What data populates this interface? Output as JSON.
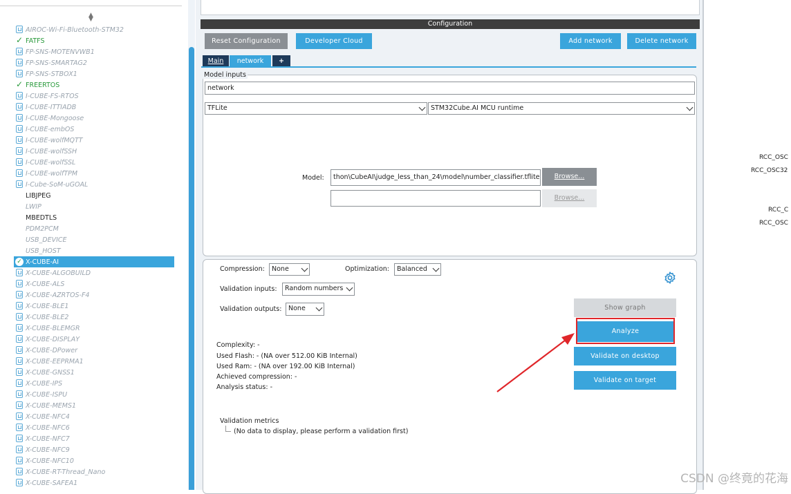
{
  "left_panel": {
    "items": [
      {
        "label": "AIROC-Wi-Fi-Bluetooth-STM32",
        "state": "pack"
      },
      {
        "label": "FATFS",
        "state": "ok"
      },
      {
        "label": "FP-SNS-MOTENVWB1",
        "state": "pack"
      },
      {
        "label": "FP-SNS-SMARTAG2",
        "state": "pack"
      },
      {
        "label": "FP-SNS-STBOX1",
        "state": "pack"
      },
      {
        "label": "FREERTOS",
        "state": "ok"
      },
      {
        "label": "I-CUBE-FS-RTOS",
        "state": "pack"
      },
      {
        "label": "I-CUBE-ITTIADB",
        "state": "pack"
      },
      {
        "label": "I-CUBE-Mongoose",
        "state": "pack"
      },
      {
        "label": "I-CUBE-embOS",
        "state": "pack"
      },
      {
        "label": "I-CUBE-wolfMQTT",
        "state": "pack"
      },
      {
        "label": "I-CUBE-wolfSSH",
        "state": "pack"
      },
      {
        "label": "I-CUBE-wolfSSL",
        "state": "pack"
      },
      {
        "label": "I-CUBE-wolfTPM",
        "state": "pack"
      },
      {
        "label": "I-Cube-SoM-uGOAL",
        "state": "pack"
      },
      {
        "label": "LIBJPEG",
        "state": "plain"
      },
      {
        "label": "LWIP",
        "state": "plaindis"
      },
      {
        "label": "MBEDTLS",
        "state": "plain"
      },
      {
        "label": "PDM2PCM",
        "state": "plaindis"
      },
      {
        "label": "USB_DEVICE",
        "state": "plaindis"
      },
      {
        "label": "USB_HOST",
        "state": "plaindis"
      },
      {
        "label": "X-CUBE-AI",
        "state": "sel"
      },
      {
        "label": "X-CUBE-ALGOBUILD",
        "state": "pack"
      },
      {
        "label": "X-CUBE-ALS",
        "state": "pack"
      },
      {
        "label": "X-CUBE-AZRTOS-F4",
        "state": "pack"
      },
      {
        "label": "X-CUBE-BLE1",
        "state": "pack"
      },
      {
        "label": "X-CUBE-BLE2",
        "state": "pack"
      },
      {
        "label": "X-CUBE-BLEMGR",
        "state": "pack"
      },
      {
        "label": "X-CUBE-DISPLAY",
        "state": "pack"
      },
      {
        "label": "X-CUBE-DPower",
        "state": "pack"
      },
      {
        "label": "X-CUBE-EEPRMA1",
        "state": "pack"
      },
      {
        "label": "X-CUBE-GNSS1",
        "state": "pack"
      },
      {
        "label": "X-CUBE-IPS",
        "state": "pack"
      },
      {
        "label": "X-CUBE-ISPU",
        "state": "pack"
      },
      {
        "label": "X-CUBE-MEMS1",
        "state": "pack"
      },
      {
        "label": "X-CUBE-NFC4",
        "state": "pack"
      },
      {
        "label": "X-CUBE-NFC6",
        "state": "pack"
      },
      {
        "label": "X-CUBE-NFC7",
        "state": "pack"
      },
      {
        "label": "X-CUBE-NFC9",
        "state": "pack"
      },
      {
        "label": "X-CUBE-NFC10",
        "state": "pack"
      },
      {
        "label": "X-CUBE-RT-Thread_Nano",
        "state": "pack"
      },
      {
        "label": "X-CUBE-SAFEA1",
        "state": "pack"
      }
    ]
  },
  "config": {
    "title": "Configuration",
    "reset_label": "Reset Configuration",
    "devcloud_label": "Developer Cloud",
    "add_network_label": "Add network",
    "delete_network_label": "Delete network",
    "tabs": [
      "Main",
      "network",
      "+"
    ]
  },
  "model_inputs": {
    "legend": "Model inputs",
    "name_value": "network",
    "framework": "TFLite",
    "runtime": "STM32Cube.AI MCU runtime",
    "model_label": "Model:",
    "model_path": "thon\\CubeAI\\judge_less_than_24\\model\\number_classifier.tflite",
    "browse_label": "Browse...",
    "browse2_label": "Browse..."
  },
  "options": {
    "compression_label": "Compression:",
    "compression_value": "None",
    "optimization_label": "Optimization:",
    "optimization_value": "Balanced",
    "val_inputs_label": "Validation inputs:",
    "val_inputs_value": "Random numbers",
    "val_outputs_label": "Validation outputs:",
    "val_outputs_value": "None",
    "show_graph_label": "Show graph",
    "analyze_label": "Analyze",
    "validate_desktop_label": "Validate on desktop",
    "validate_target_label": "Validate on target"
  },
  "analysis": {
    "complexity": "Complexity: -",
    "used_flash": "Used Flash: - (NA over 512.00 KiB Internal)",
    "used_ram": "Used Ram: - (NA over 192.00 KiB Internal)",
    "achieved_compression": "Achieved compression: -",
    "analysis_status": "Analysis status: -"
  },
  "validation": {
    "metrics_title": "Validation metrics",
    "no_data": "(No data to display, please perform a validation first)"
  },
  "right_panel": {
    "labels": [
      "RCC_OSC",
      "RCC_OSC32",
      "RCC_C",
      "RCC_OSC"
    ]
  },
  "watermark": "CSDN @终竟的花海",
  "colors": {
    "accent": "#3aa5dc",
    "dark_bar": "#3d3d3d",
    "ok_green": "#2a9a3c",
    "highlight_red": "#e0262a"
  }
}
